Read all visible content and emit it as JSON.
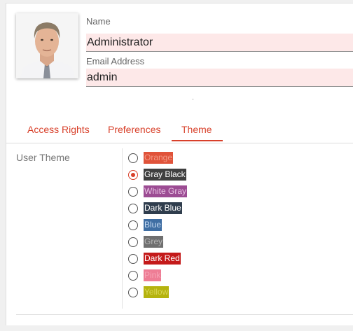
{
  "profile": {
    "name_label": "Name",
    "name_value": "Administrator",
    "email_label": "Email Address",
    "email_value": "admin"
  },
  "tabs": [
    {
      "label": "Access Rights",
      "active": false
    },
    {
      "label": "Preferences",
      "active": false
    },
    {
      "label": "Theme",
      "active": true
    }
  ],
  "theme": {
    "label": "User Theme",
    "selected": "Gray Black",
    "options": [
      {
        "label": "Orange",
        "bg": "#e0533a",
        "fg": "#f39a86"
      },
      {
        "label": "Gray Black",
        "bg": "#3f3f3f",
        "fg": "#ffffff"
      },
      {
        "label": "White Gray",
        "bg": "#9c4c93",
        "fg": "#e8c3e4"
      },
      {
        "label": "Dark Blue",
        "bg": "#2f3d4d",
        "fg": "#ffffff"
      },
      {
        "label": "Blue",
        "bg": "#3f6ea3",
        "fg": "#c7dbf3"
      },
      {
        "label": "Grey",
        "bg": "#6f6f6f",
        "fg": "#b5b5b5"
      },
      {
        "label": "Dark Red",
        "bg": "#c41a1a",
        "fg": "#ffffff"
      },
      {
        "label": "Pink",
        "bg": "#ee7d95",
        "fg": "#f5a3b5"
      },
      {
        "label": "Yellow",
        "bg": "#b5b30f",
        "fg": "#d8d655"
      }
    ]
  }
}
